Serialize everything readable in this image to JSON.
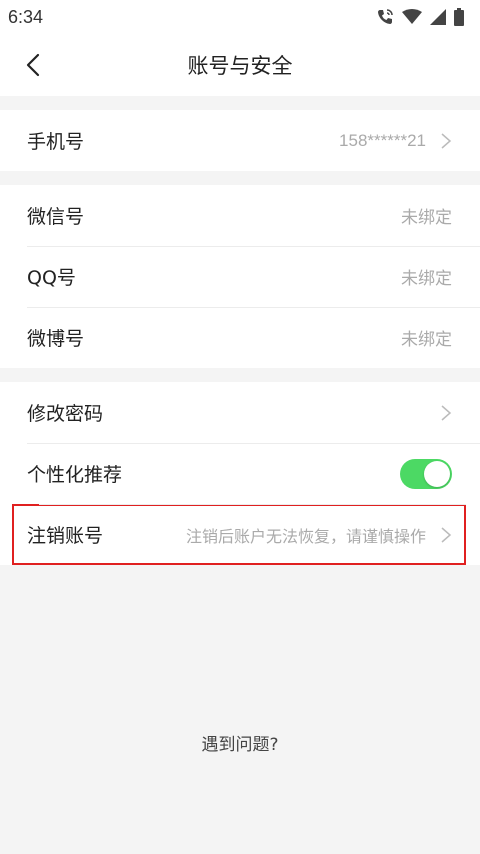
{
  "status_bar": {
    "time": "6:34"
  },
  "header": {
    "title": "账号与安全"
  },
  "phone_section": {
    "label": "手机号",
    "value": "158******21"
  },
  "bindings_section": [
    {
      "label": "微信号",
      "value": "未绑定"
    },
    {
      "label": "QQ号",
      "value": "未绑定"
    },
    {
      "label": "微博号",
      "value": "未绑定"
    }
  ],
  "settings_section": {
    "change_password_label": "修改密码",
    "personalized_label": "个性化推荐",
    "personalized_enabled": true
  },
  "deactivate": {
    "label": "注销账号",
    "hint": "注销后账户无法恢复，请谨慎操作"
  },
  "help": {
    "label": "遇到问题?"
  },
  "colors": {
    "toggle_on": "#4cd964",
    "highlight_border": "#e02020",
    "muted_text": "#aaaaaa"
  },
  "icons": {
    "back": "back-arrow-icon",
    "chevron": "chevron-right-icon",
    "call": "wifi-calling-icon",
    "wifi": "wifi-icon",
    "signal": "signal-icon",
    "battery": "battery-icon"
  }
}
